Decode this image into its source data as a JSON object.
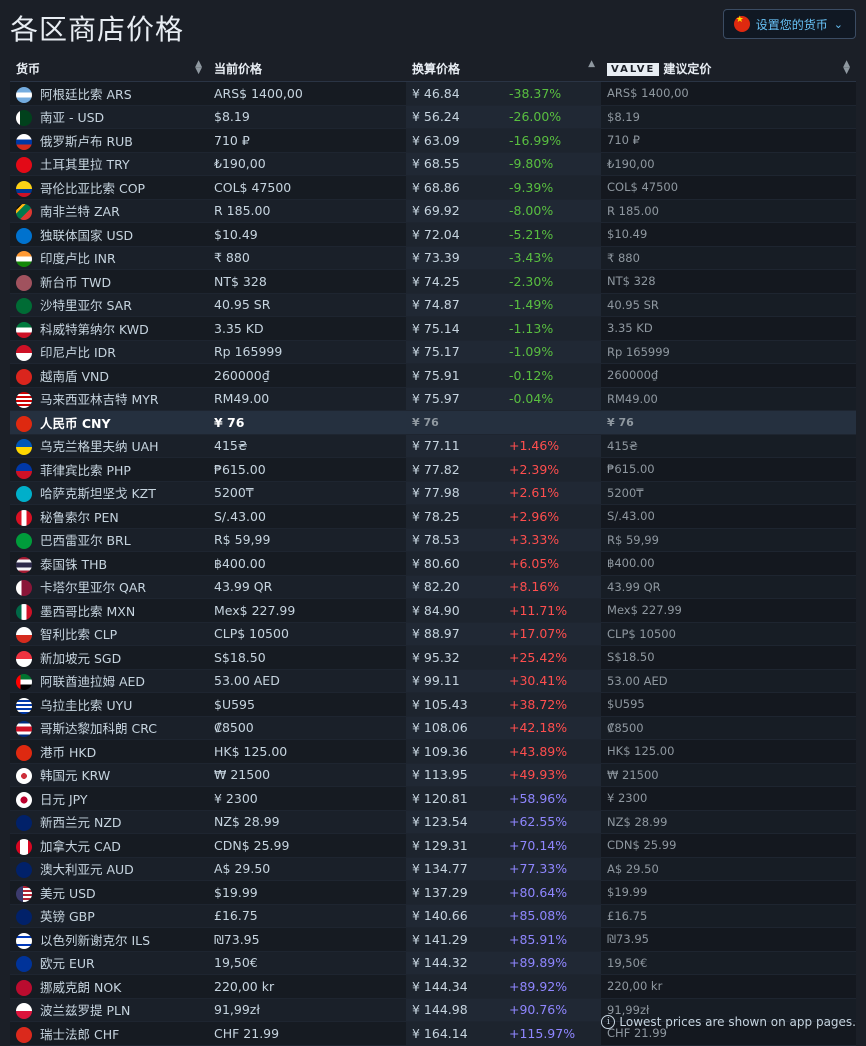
{
  "page_title": "各区商店价格",
  "set_currency_button": "设置您的货币",
  "headers": {
    "currency": "货币",
    "current_price": "当前价格",
    "converted_price": "换算价格",
    "valve_logo": "VALVE",
    "recommended_price": "建议定价"
  },
  "footer_note": "Lowest prices are shown on app pages.",
  "colors": {
    "discount": "#59bf40",
    "premium_low": "#ff4e4e",
    "premium_high": "#8f86ff",
    "accent": "#67c1f5"
  },
  "rows": [
    {
      "flag": "argentina-flag",
      "bg": "linear-gradient(#74acdf 33%,#fff 33%,#fff 66%,#74acdf 66%)",
      "name": "阿根廷比索 ARS",
      "current": "ARS$ 1400,00",
      "converted": "¥ 46.84",
      "pct": "-38.37%",
      "cls": "pct-green",
      "valve": "ARS$ 1400,00"
    },
    {
      "flag": "pakistan-flag",
      "bg": "linear-gradient(90deg,#fff 25%,#01411c 25%)",
      "name": "南亚 - USD",
      "current": "$8.19",
      "converted": "¥ 56.24",
      "pct": "-26.00%",
      "cls": "pct-green",
      "valve": "$8.19"
    },
    {
      "flag": "russia-flag",
      "bg": "linear-gradient(#fff 33%,#0039a6 33%,#0039a6 66%,#d52b1e 66%)",
      "name": "俄罗斯卢布 RUB",
      "current": "710 ₽",
      "converted": "¥ 63.09",
      "pct": "-16.99%",
      "cls": "pct-green",
      "valve": "710 ₽"
    },
    {
      "flag": "turkey-flag",
      "bg": "#e30a17",
      "name": "土耳其里拉 TRY",
      "current": "₺190,00",
      "converted": "¥ 68.55",
      "pct": "-9.80%",
      "cls": "pct-green",
      "valve": "₺190,00"
    },
    {
      "flag": "colombia-flag",
      "bg": "linear-gradient(#fcd116 50%,#003893 50%,#003893 75%,#ce1126 75%)",
      "name": "哥伦比亚比索 COP",
      "current": "COL$ 47500",
      "converted": "¥ 68.86",
      "pct": "-9.39%",
      "cls": "pct-green",
      "valve": "COL$ 47500"
    },
    {
      "flag": "south-africa-flag",
      "bg": "linear-gradient(135deg,#000 20%,#ffb612 20%,#ffb612 30%,#007a4d 30%,#007a4d 60%,#de3831 60%)",
      "name": "南非兰特 ZAR",
      "current": "R 185.00",
      "converted": "¥ 69.92",
      "pct": "-8.00%",
      "cls": "pct-green",
      "valve": "R 185.00"
    },
    {
      "flag": "cis-flag",
      "bg": "#0072ce",
      "name": "独联体国家 USD",
      "current": "$10.49",
      "converted": "¥ 72.04",
      "pct": "-5.21%",
      "cls": "pct-green",
      "valve": "$10.49"
    },
    {
      "flag": "india-flag",
      "bg": "linear-gradient(#ff9933 33%,#fff 33%,#fff 66%,#138808 66%)",
      "name": "印度卢比 INR",
      "current": "₹ 880",
      "converted": "¥ 73.39",
      "pct": "-3.43%",
      "cls": "pct-green",
      "valve": "₹ 880"
    },
    {
      "flag": "taiwan-flag",
      "bg": "#a0525e",
      "name": "新台币 TWD",
      "current": "NT$ 328",
      "converted": "¥ 74.25",
      "pct": "-2.30%",
      "cls": "pct-green",
      "valve": "NT$ 328"
    },
    {
      "flag": "saudi-flag",
      "bg": "#006c35",
      "name": "沙特里亚尔 SAR",
      "current": "40.95 SR",
      "converted": "¥ 74.87",
      "pct": "-1.49%",
      "cls": "pct-green",
      "valve": "40.95 SR"
    },
    {
      "flag": "kuwait-flag",
      "bg": "linear-gradient(#007a3d 33%,#fff 33%,#fff 66%,#ce1126 66%)",
      "name": "科威特第纳尔 KWD",
      "current": "3.35 KD",
      "converted": "¥ 75.14",
      "pct": "-1.13%",
      "cls": "pct-green",
      "valve": "3.35 KD"
    },
    {
      "flag": "indonesia-flag",
      "bg": "linear-gradient(#ce1126 50%,#fff 50%)",
      "name": "印尼卢比 IDR",
      "current": "Rp 165999",
      "converted": "¥ 75.17",
      "pct": "-1.09%",
      "cls": "pct-green",
      "valve": "Rp 165999"
    },
    {
      "flag": "vietnam-flag",
      "bg": "#da251d",
      "name": "越南盾 VND",
      "current": "260000₫",
      "converted": "¥ 75.91",
      "pct": "-0.12%",
      "cls": "pct-green",
      "valve": "260000₫"
    },
    {
      "flag": "malaysia-flag",
      "bg": "repeating-linear-gradient(#cc0001 0 2px,#fff 2px 4px)",
      "name": "马来西亚林吉特 MYR",
      "current": "RM49.00",
      "converted": "¥ 75.97",
      "pct": "-0.04%",
      "cls": "pct-green",
      "valve": "RM49.00"
    },
    {
      "flag": "china-flag",
      "bg": "#de2910",
      "name": "人民币 CNY",
      "current": "¥ 76",
      "converted": "¥ 76",
      "pct": "",
      "cls": "",
      "valve": "¥ 76",
      "base": true
    },
    {
      "flag": "ukraine-flag",
      "bg": "linear-gradient(#0057b7 50%,#ffd700 50%)",
      "name": "乌克兰格里夫纳 UAH",
      "current": "415₴",
      "converted": "¥ 77.11",
      "pct": "+1.46%",
      "cls": "pct-red",
      "valve": "415₴"
    },
    {
      "flag": "philippines-flag",
      "bg": "linear-gradient(#0038a8 50%,#ce1126 50%)",
      "name": "菲律宾比索 PHP",
      "current": "₱615.00",
      "converted": "¥ 77.82",
      "pct": "+2.39%",
      "cls": "pct-red",
      "valve": "₱615.00"
    },
    {
      "flag": "kazakhstan-flag",
      "bg": "#00afca",
      "name": "哈萨克斯坦坚戈 KZT",
      "current": "5200₸",
      "converted": "¥ 77.98",
      "pct": "+2.61%",
      "cls": "pct-red",
      "valve": "5200₸"
    },
    {
      "flag": "peru-flag",
      "bg": "linear-gradient(90deg,#d91023 33%,#fff 33%,#fff 66%,#d91023 66%)",
      "name": "秘鲁索尔 PEN",
      "current": "S/.43.00",
      "converted": "¥ 78.25",
      "pct": "+2.96%",
      "cls": "pct-red",
      "valve": "S/.43.00"
    },
    {
      "flag": "brazil-flag",
      "bg": "#009c3b",
      "name": "巴西雷亚尔 BRL",
      "current": "R$ 59,99",
      "converted": "¥ 78.53",
      "pct": "+3.33%",
      "cls": "pct-red",
      "valve": "R$ 59,99"
    },
    {
      "flag": "thailand-flag",
      "bg": "linear-gradient(#a51931 16%,#f4f5f8 16%,#f4f5f8 33%,#2d2a4a 33%,#2d2a4a 66%,#f4f5f8 66%,#f4f5f8 83%,#a51931 83%)",
      "name": "泰国铢 THB",
      "current": "฿400.00",
      "converted": "¥ 80.60",
      "pct": "+6.05%",
      "cls": "pct-red",
      "valve": "฿400.00"
    },
    {
      "flag": "qatar-flag",
      "bg": "linear-gradient(90deg,#fff 35%,#8a1538 35%)",
      "name": "卡塔尔里亚尔 QAR",
      "current": "43.99 QR",
      "converted": "¥ 82.20",
      "pct": "+8.16%",
      "cls": "pct-red",
      "valve": "43.99 QR"
    },
    {
      "flag": "mexico-flag",
      "bg": "linear-gradient(90deg,#006847 33%,#fff 33%,#fff 66%,#ce1126 66%)",
      "name": "墨西哥比索 MXN",
      "current": "Mex$ 227.99",
      "converted": "¥ 84.90",
      "pct": "+11.71%",
      "cls": "pct-red",
      "valve": "Mex$ 227.99"
    },
    {
      "flag": "chile-flag",
      "bg": "linear-gradient(#fff 50%,#d52b1e 50%)",
      "name": "智利比索 CLP",
      "current": "CLP$ 10500",
      "converted": "¥ 88.97",
      "pct": "+17.07%",
      "cls": "pct-red",
      "valve": "CLP$ 10500"
    },
    {
      "flag": "singapore-flag",
      "bg": "linear-gradient(#ef3340 50%,#fff 50%)",
      "name": "新加坡元 SGD",
      "current": "S$18.50",
      "converted": "¥ 95.32",
      "pct": "+25.42%",
      "cls": "pct-red",
      "valve": "S$18.50"
    },
    {
      "flag": "uae-flag",
      "bg": "linear-gradient(90deg,#ff0000 28%,transparent 28%),linear-gradient(#00732f 33%,#fff 33%,#fff 66%,#000 66%)",
      "name": "阿联酋迪拉姆 AED",
      "current": "53.00 AED",
      "converted": "¥ 99.11",
      "pct": "+30.41%",
      "cls": "pct-red",
      "valve": "53.00 AED"
    },
    {
      "flag": "uruguay-flag",
      "bg": "repeating-linear-gradient(#fff 0 2px,#0038a8 2px 4px)",
      "name": "乌拉圭比索 UYU",
      "current": "$U595",
      "converted": "¥ 105.43",
      "pct": "+38.72%",
      "cls": "pct-red",
      "valve": "$U595"
    },
    {
      "flag": "costa-rica-flag",
      "bg": "linear-gradient(#002b7f 17%,#fff 17%,#fff 33%,#ce1126 33%,#ce1126 66%,#fff 66%,#fff 83%,#002b7f 83%)",
      "name": "哥斯达黎加科朗 CRC",
      "current": "₡8500",
      "converted": "¥ 108.06",
      "pct": "+42.18%",
      "cls": "pct-red",
      "valve": "₡8500"
    },
    {
      "flag": "hongkong-flag",
      "bg": "#de2910",
      "name": "港币 HKD",
      "current": "HK$ 125.00",
      "converted": "¥ 109.36",
      "pct": "+43.89%",
      "cls": "pct-red",
      "valve": "HK$ 125.00"
    },
    {
      "flag": "korea-flag",
      "bg": "radial-gradient(circle,#cd2e3a 25%,#fff 26%)",
      "name": "韩国元 KRW",
      "current": "₩ 21500",
      "converted": "¥ 113.95",
      "pct": "+49.93%",
      "cls": "pct-red",
      "valve": "₩ 21500"
    },
    {
      "flag": "japan-flag",
      "bg": "radial-gradient(circle,#bc002d 30%,#fff 32%)",
      "name": "日元 JPY",
      "current": "¥ 2300",
      "converted": "¥ 120.81",
      "pct": "+58.96%",
      "cls": "pct-purple",
      "valve": "¥ 2300"
    },
    {
      "flag": "new-zealand-flag",
      "bg": "#012169",
      "name": "新西兰元 NZD",
      "current": "NZ$ 28.99",
      "converted": "¥ 123.54",
      "pct": "+62.55%",
      "cls": "pct-purple",
      "valve": "NZ$ 28.99"
    },
    {
      "flag": "canada-flag",
      "bg": "linear-gradient(90deg,#d80621 25%,#fff 25%,#fff 75%,#d80621 75%)",
      "name": "加拿大元 CAD",
      "current": "CDN$ 25.99",
      "converted": "¥ 129.31",
      "pct": "+70.14%",
      "cls": "pct-purple",
      "valve": "CDN$ 25.99"
    },
    {
      "flag": "australia-flag",
      "bg": "#012169",
      "name": "澳大利亚元 AUD",
      "current": "A$ 29.50",
      "converted": "¥ 134.77",
      "pct": "+77.33%",
      "cls": "pct-purple",
      "valve": "A$ 29.50"
    },
    {
      "flag": "usa-flag",
      "bg": "linear-gradient(90deg,#3c3b6e 45%,transparent 45%),repeating-linear-gradient(#b22234 0 2px,#fff 2px 4px)",
      "name": "美元 USD",
      "current": "$19.99",
      "converted": "¥ 137.29",
      "pct": "+80.64%",
      "cls": "pct-purple",
      "valve": "$19.99"
    },
    {
      "flag": "uk-flag",
      "bg": "#012169",
      "name": "英镑 GBP",
      "current": "£16.75",
      "converted": "¥ 140.66",
      "pct": "+85.08%",
      "cls": "pct-purple",
      "valve": "£16.75"
    },
    {
      "flag": "israel-flag",
      "bg": "linear-gradient(#fff 20%,#0038b8 20%,#0038b8 30%,#fff 30%,#fff 70%,#0038b8 70%,#0038b8 80%,#fff 80%)",
      "name": "以色列新谢克尔 ILS",
      "current": "₪73.95",
      "converted": "¥ 141.29",
      "pct": "+85.91%",
      "cls": "pct-purple",
      "valve": "₪73.95"
    },
    {
      "flag": "eu-flag",
      "bg": "#003399",
      "name": "欧元 EUR",
      "current": "19,50€",
      "converted": "¥ 144.32",
      "pct": "+89.89%",
      "cls": "pct-purple",
      "valve": "19,50€"
    },
    {
      "flag": "norway-flag",
      "bg": "#ba0c2f",
      "name": "挪威克朗 NOK",
      "current": "220,00 kr",
      "converted": "¥ 144.34",
      "pct": "+89.92%",
      "cls": "pct-purple",
      "valve": "220,00 kr"
    },
    {
      "flag": "poland-flag",
      "bg": "linear-gradient(#fff 50%,#dc143c 50%)",
      "name": "波兰兹罗提 PLN",
      "current": "91,99zł",
      "converted": "¥ 144.98",
      "pct": "+90.76%",
      "cls": "pct-purple",
      "valve": "91,99zł"
    },
    {
      "flag": "switzerland-flag",
      "bg": "#da291c",
      "name": "瑞士法郎 CHF",
      "current": "CHF 21.99",
      "converted": "¥ 164.14",
      "pct": "+115.97%",
      "cls": "pct-purple",
      "valve": "CHF 21.99"
    }
  ]
}
